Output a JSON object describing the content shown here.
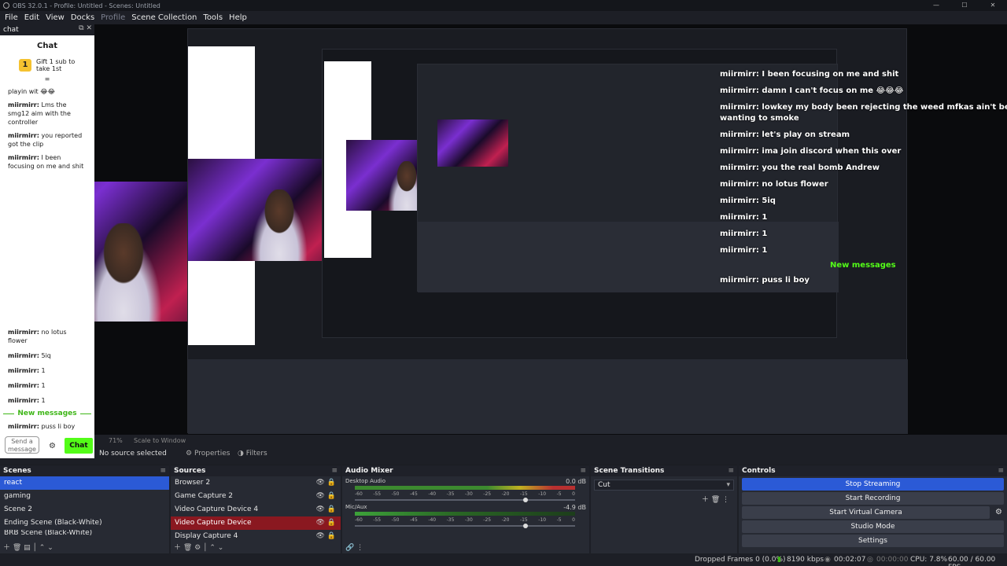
{
  "window": {
    "title": "OBS 32.0.1 - Profile: Untitled - Scenes: Untitled",
    "controls": [
      "—",
      "☐",
      "✕"
    ]
  },
  "menu": [
    "File",
    "Edit",
    "View",
    "Docks",
    "Profile",
    "Scene Collection",
    "Tools",
    "Help"
  ],
  "chat_dock": {
    "tab_label": "chat",
    "title": "Chat",
    "gift_text": "Gift 1 sub to take 1st",
    "messages_top": [
      {
        "user": "",
        "text": "playin wit 😂😂"
      },
      {
        "user": "miirmirr:",
        "text": "Lms the smg12 aim with the controller"
      },
      {
        "user": "miirmirr:",
        "text": "you reported got the clip"
      },
      {
        "user": "miirmirr:",
        "text": "I been focusing on me and shit"
      }
    ],
    "messages_bottom": [
      {
        "user": "miirmirr:",
        "text": "no lotus flower"
      },
      {
        "user": "miirmirr:",
        "text": "5iq"
      },
      {
        "user": "miirmirr:",
        "text": "1"
      },
      {
        "user": "miirmirr:",
        "text": "1"
      },
      {
        "user": "miirmirr:",
        "text": "1"
      }
    ],
    "new_messages": "New messages",
    "last_message": {
      "user": "miirmirr:",
      "text": "puss li boy"
    },
    "input_placeholder": "Send a message",
    "send_label": "Chat"
  },
  "preview_overlay": {
    "lines": [
      "miirmirr: I been focusing on me and shit",
      "miirmirr: damn I can't focus on me 😂😂😂",
      "miirmirr: lowkey my body been rejecting the weed mfkas ain't been",
      "wanting to smoke",
      "miirmirr: let's play on stream",
      "miirmirr: ima join discord when this over",
      "miirmirr: you the real bomb Andrew",
      "miirmirr: no lotus flower",
      "miirmirr: 5iq",
      "miirmirr: 1",
      "miirmirr: 1",
      "miirmirr: 1",
      "miirmirr: puss li boy"
    ],
    "new_messages": "New messages"
  },
  "preview_controls": {
    "zoom": "71%",
    "scale": "Scale to Window",
    "no_source": "No source selected",
    "properties": "Properties",
    "filters": "Filters"
  },
  "scenes": {
    "title": "Scenes",
    "items": [
      "react",
      "gaming",
      "Scene 2",
      "Ending Scene (Black-White)",
      "BRB Scene (Black-White)"
    ],
    "selected": "react"
  },
  "sources": {
    "title": "Sources",
    "items": [
      "Browser 2",
      "Game Capture 2",
      "Video Capture Device 4",
      "Video Capture Device",
      "Display Capture 4"
    ],
    "highlighted": "Video Capture Device"
  },
  "audio_mixer": {
    "title": "Audio Mixer",
    "channels": [
      {
        "name": "Desktop Audio",
        "db": "0.0 dB"
      },
      {
        "name": "Mic/Aux",
        "db": "-4.9 dB"
      }
    ],
    "scale": [
      "-60",
      "-55",
      "-50",
      "-45",
      "-40",
      "-35",
      "-30",
      "-25",
      "-20",
      "-15",
      "-10",
      "-5",
      "0"
    ]
  },
  "scene_transitions": {
    "title": "Scene Transitions",
    "selected": "Cut"
  },
  "controls": {
    "title": "Controls",
    "buttons": [
      "Stop Streaming",
      "Start Recording",
      "Start Virtual Camera",
      "Studio Mode",
      "Settings"
    ]
  },
  "status": {
    "dropped_frames": "Dropped Frames 0 (0.0%)",
    "bitrate": "8190 kbps",
    "stream_time": "00:02:07",
    "rec_time": "00:00:00",
    "cpu": "CPU: 7.8%",
    "fps": "60.00 / 60.00 FPS"
  },
  "colors": {
    "accent": "#2b5ad6",
    "kick_green": "#53fc18",
    "alert_red": "#8a1820"
  }
}
